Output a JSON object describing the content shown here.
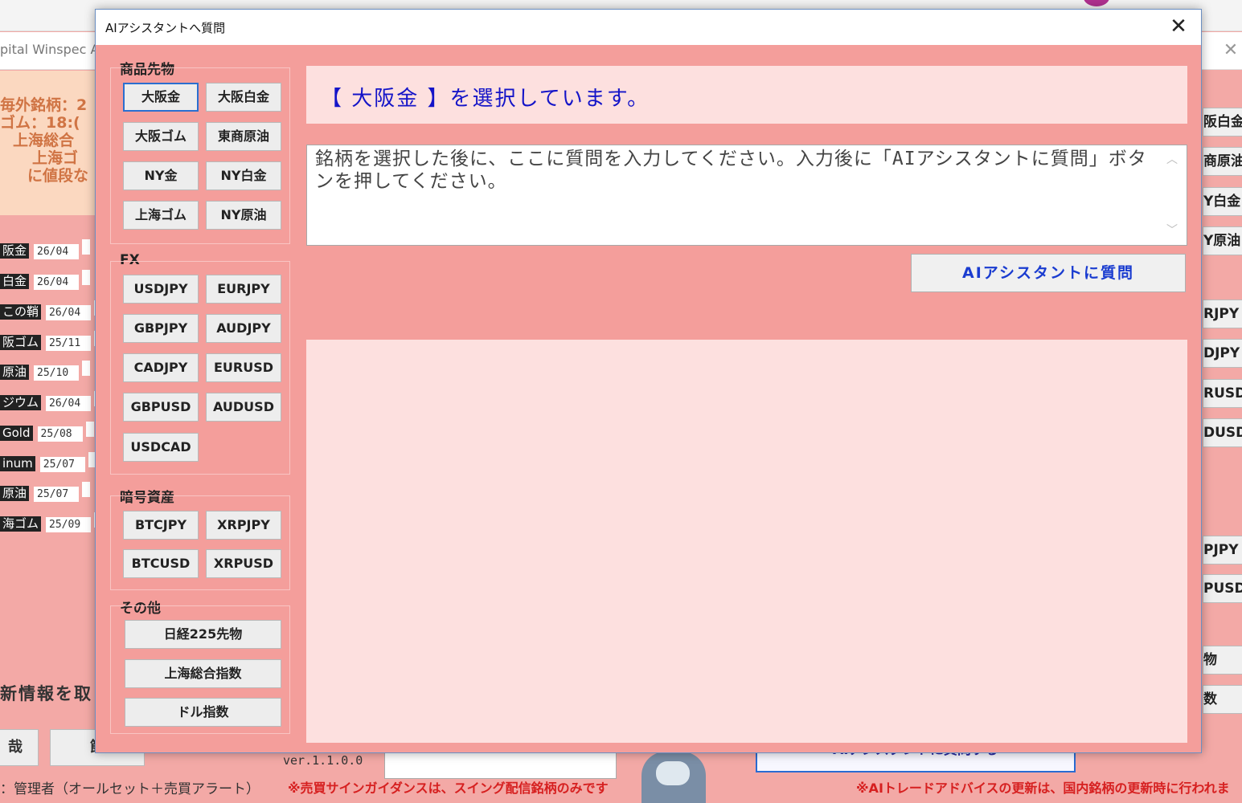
{
  "background": {
    "window_title": "pital Winspec A",
    "info_lines": [
      "毎外銘柄：2",
      "ゴム：18:(",
      "上海総合",
      "上海ゴ",
      "に値段な"
    ],
    "rows": [
      {
        "name": "阪金",
        "date": "26/04"
      },
      {
        "name": "白金",
        "date": "26/04"
      },
      {
        "name": "この鞘",
        "date": "26/04"
      },
      {
        "name": "阪ゴム",
        "date": "25/11"
      },
      {
        "name": "原油",
        "date": "25/10"
      },
      {
        "name": "ジウム",
        "date": "26/04"
      },
      {
        "name": "Gold",
        "date": "25/08"
      },
      {
        "name": "inum",
        "date": "25/07"
      },
      {
        "name": "原油",
        "date": "25/07"
      },
      {
        "name": "海ゴム",
        "date": "25/09"
      }
    ],
    "new_info_text": "新情報を取",
    "bottom_btn_1": "哉",
    "bottom_btn_2": "節",
    "version": "ver.1.1.0.0",
    "ask_button_bg": "AIアシスタントに質問する",
    "status_user": "：管理者（オールセット＋売買アラート）",
    "warning_1": "※売買サインガイダンスは、スイング配信銘柄のみです",
    "warning_2": "※AIトレードアドバイスの更新は、国内銘柄の更新時に行われま",
    "right_buttons": [
      "阪白金",
      "商原油",
      "Y白金",
      "Y原油",
      "RJPY",
      "DJPY",
      "RUSD",
      "DUSD",
      "PJPY",
      "PUSD",
      "物",
      "数"
    ]
  },
  "dialog": {
    "title": "AIアシスタントへ質問",
    "close_icon": "close-icon",
    "groups": {
      "commodities": {
        "label": "商品先物",
        "buttons": [
          "大阪金",
          "大阪白金",
          "大阪ゴム",
          "東商原油",
          "NY金",
          "NY白金",
          "上海ゴム",
          "NY原油"
        ]
      },
      "fx": {
        "label": "FX",
        "buttons": [
          "USDJPY",
          "EURJPY",
          "GBPJPY",
          "AUDJPY",
          "CADJPY",
          "EURUSD",
          "GBPUSD",
          "AUDUSD",
          "USDCAD"
        ]
      },
      "crypto": {
        "label": "暗号資産",
        "buttons": [
          "BTCJPY",
          "XRPJPY",
          "BTCUSD",
          "XRPUSD"
        ]
      },
      "other": {
        "label": "その他",
        "buttons": [
          "日経225先物",
          "上海総合指数",
          "ドル指数"
        ]
      }
    },
    "selected_symbol": "大阪金",
    "selected_text": "【 大阪金 】を選択しています。",
    "question_placeholder": "銘柄を選択した後に、ここに質問を入力してください。入力後に「AIアシスタントに質問」ボタンを押してください。",
    "ask_button_label": "AIアシスタントに質問",
    "answer_text": ""
  },
  "colors": {
    "dialog_bg": "#f49e9b",
    "panel_bg": "#fde0df",
    "selected_text": "#1414c8",
    "selected_border": "#2b6fd0",
    "ask_text": "#1a3cd0"
  }
}
